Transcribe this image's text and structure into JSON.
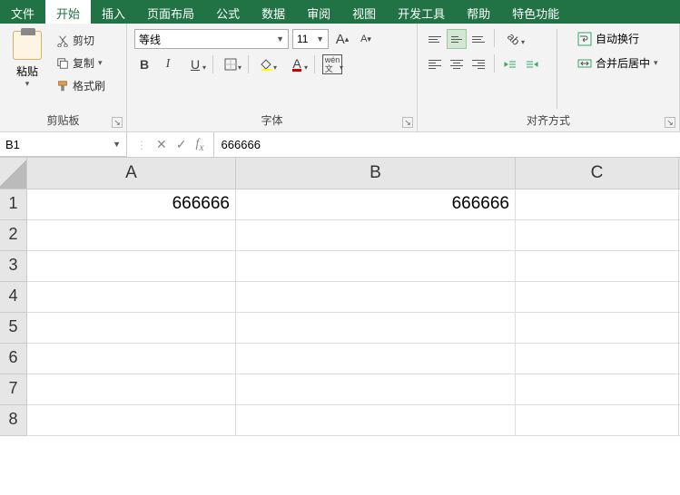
{
  "menu": {
    "items": [
      "文件",
      "开始",
      "插入",
      "页面布局",
      "公式",
      "数据",
      "审阅",
      "视图",
      "开发工具",
      "帮助",
      "特色功能"
    ],
    "active": 1
  },
  "ribbon": {
    "clipboard": {
      "paste": "粘贴",
      "cut": "剪切",
      "copy": "复制",
      "format_painter": "格式刷",
      "label": "剪贴板"
    },
    "font": {
      "name": "等线",
      "size": "11",
      "label": "字体"
    },
    "align": {
      "wrap": "自动换行",
      "merge": "合并后居中",
      "label": "对齐方式"
    }
  },
  "formula_bar": {
    "name_box": "B1",
    "formula": "666666"
  },
  "grid": {
    "columns": [
      "A",
      "B",
      "C"
    ],
    "rows": [
      "1",
      "2",
      "3",
      "4",
      "5",
      "6",
      "7",
      "8"
    ],
    "cells": {
      "A1": "666666",
      "B1": "666666"
    }
  }
}
